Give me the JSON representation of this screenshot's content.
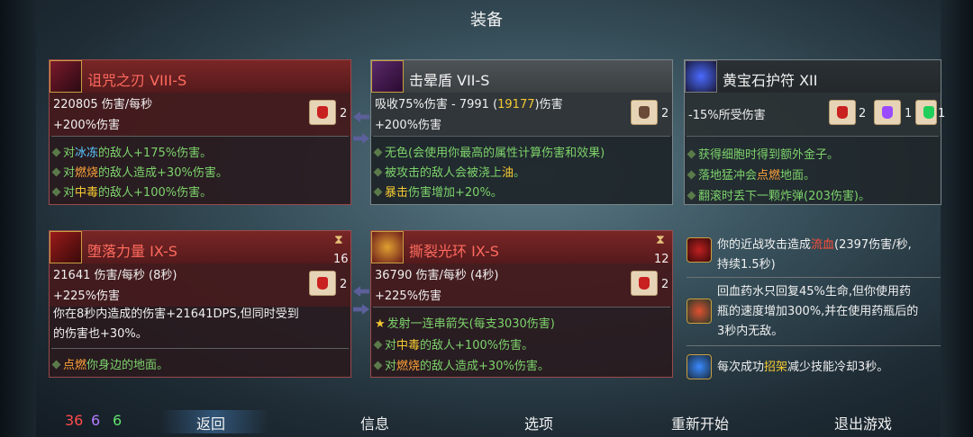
{
  "title": "装备",
  "slots": [
    {
      "name": "诅咒之刃 VIII-S",
      "stat1": "220805 伤害/每秒",
      "stat2": "+200%伤害",
      "scrolls": [
        {
          "color": "red",
          "count": "2"
        }
      ],
      "effects": [
        [
          "对",
          "冰冻",
          "的敌人+175%伤害。"
        ],
        [
          "对",
          "燃烧",
          "的敌人造成+30%伤害。"
        ],
        [
          "对",
          "中毒",
          "的敌人+100%伤害。"
        ]
      ]
    },
    {
      "name": "击晕盾 VII-S",
      "stat1a": "吸收75%伤害 - 7991 (",
      "stat1b": "19177",
      "stat1c": ")伤害",
      "stat2": "+200%伤害",
      "scrolls": [
        {
          "color": "brown",
          "count": "2"
        }
      ],
      "effects": [
        [
          "无色(会使用你最高的属性计算伤害和效果)"
        ],
        [
          "被攻击的敌人会被浇上",
          "油",
          "。"
        ],
        [
          "",
          "暴击",
          "伤害增加+20%。"
        ]
      ]
    },
    {
      "name": "黄宝石护符 XII",
      "stat1": "-15%所受伤害",
      "scrolls": [
        {
          "color": "red",
          "count": "2"
        },
        {
          "color": "purple",
          "count": "1"
        },
        {
          "color": "green",
          "count": "1"
        }
      ],
      "effects": [
        [
          "获得细胞时得到额外金子。"
        ],
        [
          "落地猛冲会",
          "点燃",
          "地面。"
        ],
        [
          "翻滚时丢下一颗炸弹(203伤害)。"
        ]
      ]
    },
    {
      "name": "堕落力量 IX-S",
      "stat1": "21641 伤害/每秒 (8秒)",
      "stat2": "+225%伤害",
      "cooldown": "16",
      "scrolls": [
        {
          "color": "red",
          "count": "2"
        }
      ],
      "desc1": "你在8秒内造成的伤害+21641DPS,但同时受到",
      "desc2": "的伤害也+30%。",
      "effects": [
        [
          "",
          "点燃",
          "你身边的地面。"
        ]
      ]
    },
    {
      "name": "撕裂光环 IX-S",
      "stat1": "36790 伤害/每秒 (4秒)",
      "stat2": "+225%伤害",
      "cooldown": "12",
      "scrolls": [
        {
          "color": "red",
          "count": "2"
        }
      ],
      "star_effect": "发射一连串箭矢(每支3030伤害)",
      "effects": [
        [
          "对",
          "中毒",
          "的敌人+100%伤害。"
        ],
        [
          "对",
          "燃烧",
          "的敌人造成+30%伤害。"
        ]
      ]
    }
  ],
  "mutations": [
    {
      "a": "你的近战攻击造成",
      "b": "流血",
      "c": "(2397伤害/秒,",
      "line2": "持续1.5秒)"
    },
    {
      "line1": "回血药水只回复45%生命,但你使用药",
      "line2": "瓶的速度增加300%,并在使用药瓶后的",
      "line3": "3秒内无敌。"
    },
    {
      "a": "每次成功",
      "b": "招架",
      "c": "减少技能冷却3秒。"
    }
  ],
  "footer": {
    "stat_red": "36",
    "stat_purple": "6",
    "stat_green": "6",
    "nav": [
      "返回",
      "信息",
      "选项",
      "重新开始",
      "退出游戏"
    ]
  },
  "colors": {
    "red_stat": "#ff4a4a",
    "purple_stat": "#b27cff",
    "green_stat": "#5fe06a"
  }
}
